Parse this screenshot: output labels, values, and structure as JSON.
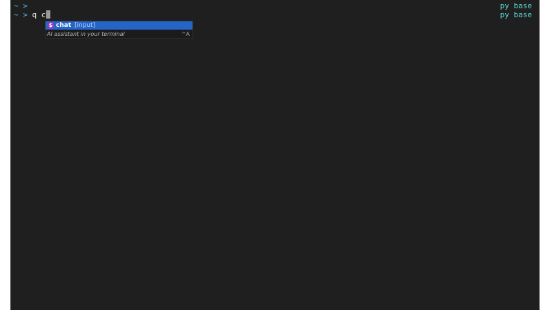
{
  "prompt": {
    "tilde": "~",
    "arrow": ">"
  },
  "lines": [
    {
      "command": ""
    },
    {
      "command": "q c"
    }
  ],
  "right_status": [
    "py base",
    "py base"
  ],
  "autocomplete": {
    "icon_glyph": "$",
    "icon_name": "dollar-terminal-icon",
    "item_name": "chat",
    "item_arg": "[input]",
    "description": "AI assistant in your terminal",
    "shortcut": "^A"
  },
  "colors": {
    "background": "#1f1f1f",
    "prompt": "#4fc1e9",
    "status": "#5fd7d7",
    "selection": "#2565c8",
    "icon_bg": "#8a3fc4"
  }
}
